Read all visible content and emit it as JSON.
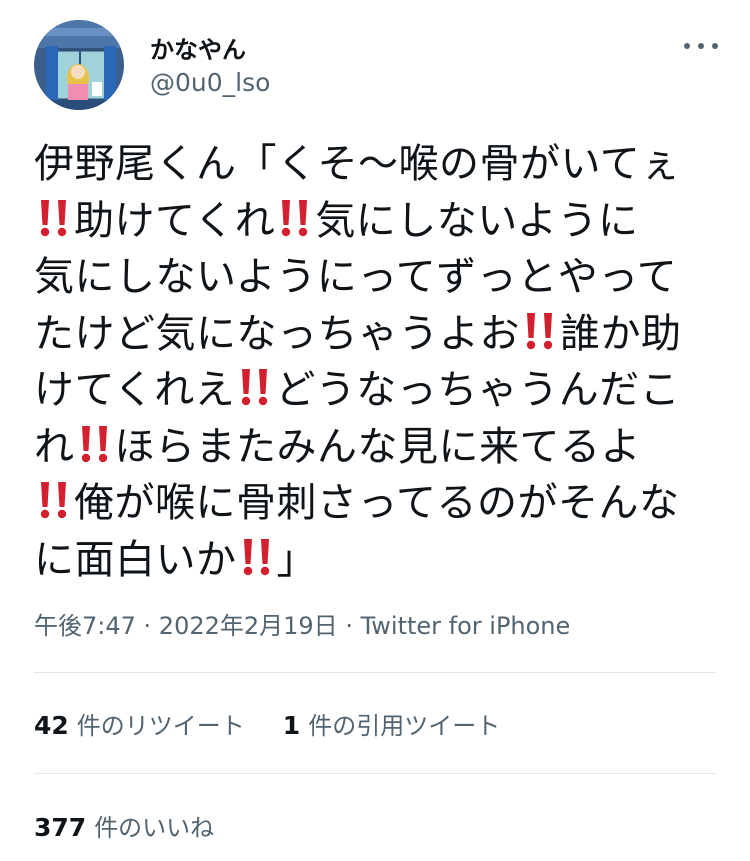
{
  "user": {
    "display_name": "かなやん",
    "handle": "@0u0_lso"
  },
  "icons": {
    "avatar": "avatar-anime-character-image",
    "more": "more-horizontal-icon",
    "emphasis": "double-exclamation-icon"
  },
  "colors": {
    "text": "#0f1419",
    "secondary": "#536471",
    "divider": "#e3e6e9",
    "exclamation": "#d2202f"
  },
  "tweet": {
    "segments": [
      "伊野尾くん「くそ〜喉の骨がいてぇ",
      "助けてくれ",
      "気にしないように",
      "気にしないようにってずっとやって",
      "たけど気になっちゃうよお",
      "誰か助",
      "けてくれえ",
      "どうなっちゃうんだこ",
      "れ",
      "ほらまたみんな見に来てるよ",
      "俺が喉に骨刺さってるのがそんな",
      "に面白いか",
      "」"
    ]
  },
  "meta": {
    "time": "午後7:47",
    "separator1": " · ",
    "date": "2022年2月19日",
    "separator2": " · ",
    "source": "Twitter for iPhone"
  },
  "stats": {
    "retweets_count": "42",
    "retweets_label": "件のリツイート",
    "quotes_count": "1",
    "quotes_label": "件の引用ツイート",
    "likes_count": "377",
    "likes_label": "件のいいね"
  }
}
